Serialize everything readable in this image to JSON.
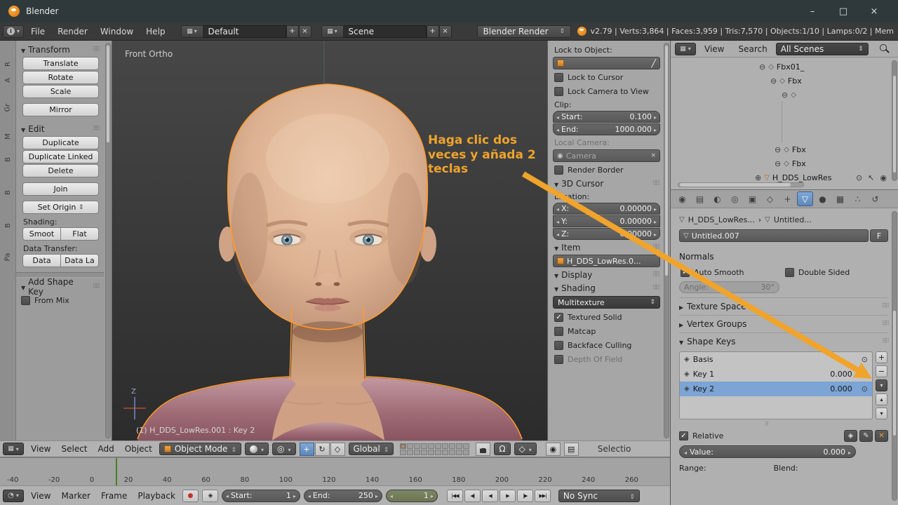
{
  "icons": {
    "info": "i",
    "grid": "▦",
    "add": "+",
    "close": "×",
    "eyedropper": "╱",
    "camera": "◉",
    "expand_open": "⊖",
    "expand_closed": "⊕",
    "node": "◇",
    "mesh": "▽",
    "eye": "⊙",
    "select_arrow": "↖",
    "render_camera": "◉",
    "shape_key": "◈",
    "plus": "+",
    "minus": "−",
    "menu_down": "▾",
    "up": "▴",
    "down": "▾",
    "pin": "◈",
    "edit": "✎",
    "clear": "✕",
    "record": "●",
    "magnet": "Ω",
    "rotate": "↻",
    "scale": "◇",
    "translate": "+",
    "pivot": "◎",
    "clock": "◔",
    "snap": "◇",
    "tabs": [
      "◉",
      "▤",
      "◐",
      "◎",
      "▣",
      "◇",
      "+",
      "▽",
      "●",
      "▦",
      "∴",
      "↺"
    ]
  },
  "titlebar": {
    "title": "Blender",
    "minimize": "–",
    "maximize": "□",
    "close": "×"
  },
  "infobar": {
    "menus": [
      "File",
      "Render",
      "Window",
      "Help"
    ],
    "layout_value": "Default",
    "scene_value": "Scene",
    "engine": "Blender Render",
    "stats": "v2.79 | Verts:3,864 | Faces:3,959 | Tris:7,570 | Objects:1/10 | Lamps:0/2 | Mem"
  },
  "toolshelf": {
    "tabs": [
      "R",
      "A",
      "Gr",
      "M",
      "B",
      "B",
      "B",
      "Pa"
    ],
    "transform_title": "Transform",
    "translate": "Translate",
    "rotate": "Rotate",
    "scale": "Scale",
    "mirror": "Mirror",
    "edit_title": "Edit",
    "duplicate": "Duplicate",
    "duplicate_linked": "Duplicate Linked",
    "delete": "Delete",
    "join": "Join",
    "set_origin": "Set Origin",
    "shading_label": "Shading:",
    "smooth": "Smoot",
    "flat": "Flat",
    "data_transfer_label": "Data Transfer:",
    "data": "Data",
    "data_layout": "Data La",
    "add_shape_key_title": "Add Shape Key",
    "from_mix": "From Mix"
  },
  "viewport": {
    "view_label": "Front Ortho",
    "object_label": "(1) H_DDS_LowRes.001 : Key 2",
    "axis_z": "Z"
  },
  "annotation": {
    "line1": "Haga clic dos",
    "line2": "veces y añada 2",
    "line3": "teclas"
  },
  "npanel": {
    "lock_to_object": "Lock to Object:",
    "lock_to_cursor": "Lock to Cursor",
    "lock_camera_to_view": "Lock Camera to View",
    "clip_label": "Clip:",
    "start_label": "Start:",
    "start_value": "0.100",
    "end_label": "End:",
    "end_value": "1000.000",
    "local_camera_label": "Local Camera:",
    "camera_value": "Camera",
    "render_border": "Render Border",
    "cursor_title": "3D Cursor",
    "location_label": "Location:",
    "x_label": "X:",
    "x_value": "0.00000",
    "y_label": "Y:",
    "y_value": "0.00000",
    "z_label": "Z:",
    "z_value": "0.00000",
    "item_title": "Item",
    "item_name": "H_DDS_LowRes.0...",
    "display_title": "Display",
    "shading_title": "Shading",
    "shading_mode": "Multitexture",
    "textured_solid": "Textured Solid",
    "matcap": "Matcap",
    "backface_culling": "Backface Culling",
    "depth_of_field": "Depth Of Field"
  },
  "outliner": {
    "view": "View",
    "search": "Search",
    "scenes_filter": "All Scenes",
    "row1": "Fbx01_",
    "row2": "Fbx",
    "row3": "",
    "row4": "Fbx",
    "row5": "Fbx",
    "row6": "H_DDS_LowRes"
  },
  "props": {
    "breadcrumb_object": "H_DDS_LowRes...",
    "breadcrumb_sep": "›",
    "breadcrumb_data": "Untitled...",
    "name_value": "Untitled.007",
    "fake_user": "F",
    "normals_title": "Normals",
    "auto_smooth": "Auto Smooth",
    "double_sided": "Double Sided",
    "angle_label": "Angle:",
    "angle_value": "30°",
    "texture_space": "Texture Space",
    "vertex_groups": "Vertex Groups",
    "shape_keys_title": "Shape Keys",
    "sk1": "Basis",
    "sk2": "Key 1",
    "sk2_value": "0.000",
    "sk3": "Key 2",
    "sk3_value": "0.000",
    "relative": "Relative",
    "value_label": "Value:",
    "value": "0.000",
    "range_label": "Range:",
    "blend_label": "Blend:"
  },
  "viewheader": {
    "menus": [
      "View",
      "Select",
      "Add",
      "Object"
    ],
    "mode": "Object Mode",
    "orientation": "Global",
    "selection_cut": "Selectio"
  },
  "timeline": {
    "numbers": [
      "-40",
      "-20",
      "0",
      "20",
      "40",
      "60",
      "80",
      "100",
      "120",
      "140",
      "160",
      "180",
      "200",
      "220",
      "240",
      "260"
    ],
    "menus": [
      "View",
      "Marker",
      "Frame",
      "Playback"
    ],
    "start_label": "Start:",
    "start_value": "1",
    "end_label": "End:",
    "end_value": "250",
    "frame_value": "1",
    "play_buttons": [
      "|◀◀",
      "◀|",
      "◀",
      "▶",
      "|▶",
      "▶▶|"
    ],
    "sync": "No Sync"
  }
}
